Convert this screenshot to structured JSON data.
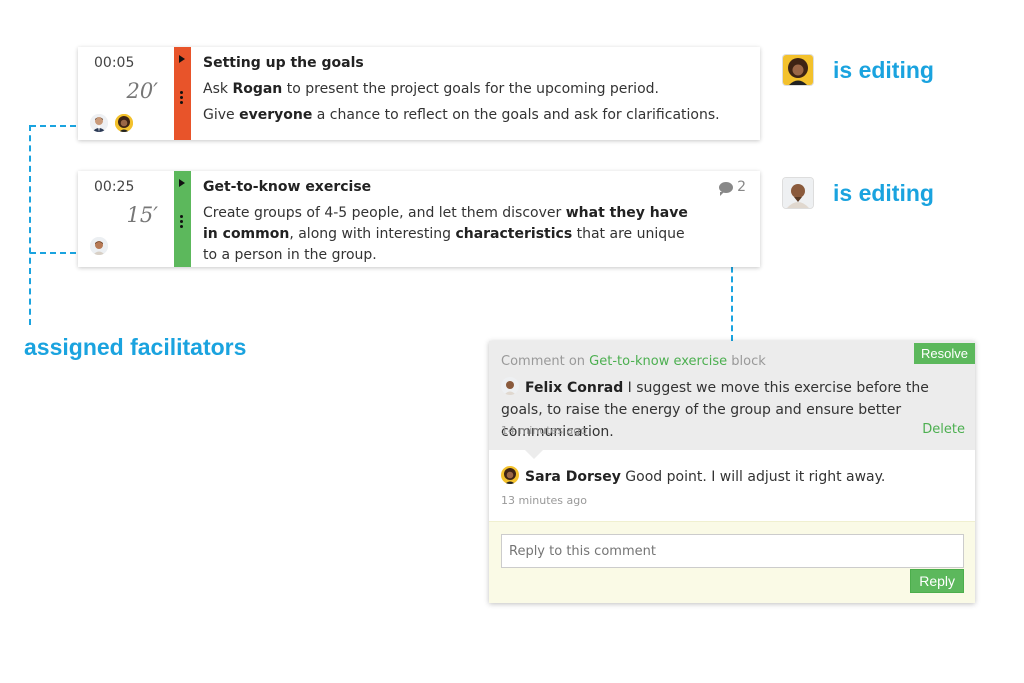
{
  "blocks": [
    {
      "start": "00:05",
      "duration": "20′",
      "color": "#e8542a",
      "title": "Setting up the goals",
      "line1_pre": "Ask ",
      "line1_bold": "Rogan",
      "line1_post": " to present the project goals for the upcoming period.",
      "line2_pre": "Give ",
      "line2_bold": "everyone",
      "line2_post": " a chance to reflect on the goals and ask for clarifications."
    },
    {
      "start": "00:25",
      "duration": "15′",
      "color": "#5cb85c",
      "title": "Get-to-know exercise",
      "p1": "Create groups of 4-5 people, and let them discover ",
      "b1": "what they have in common",
      "p2": ", along with interesting ",
      "b2": "characteristics",
      "p3": " that are unique to a person in the group.",
      "comment_count": "2"
    }
  ],
  "editing_label_1": "is editing",
  "editing_label_2": "is editing",
  "assigned_label": "assigned facilitators",
  "comment_panel": {
    "header_prefix": "Comment on ",
    "header_link": "Get-to-know exercise",
    "header_suffix": " block",
    "resolve_label": "Resolve",
    "comments": [
      {
        "author": "Felix Conrad",
        "text": " I suggest we move this exercise before the goals, to raise the energy of the group and ensure better communication.",
        "time": "14 minutes ago"
      },
      {
        "author": "Sara Dorsey",
        "text": " Good point. I will adjust it right away.",
        "time": "13 minutes ago"
      }
    ],
    "delete_label": "Delete",
    "reply_placeholder": "Reply to this comment",
    "reply_button": "Reply"
  },
  "colors": {
    "accent": "#1aa3df",
    "green": "#5cb85c",
    "orange": "#e8542a"
  },
  "icons": [
    "play-icon",
    "drag-handle-icon",
    "comment-icon",
    "avatar"
  ]
}
